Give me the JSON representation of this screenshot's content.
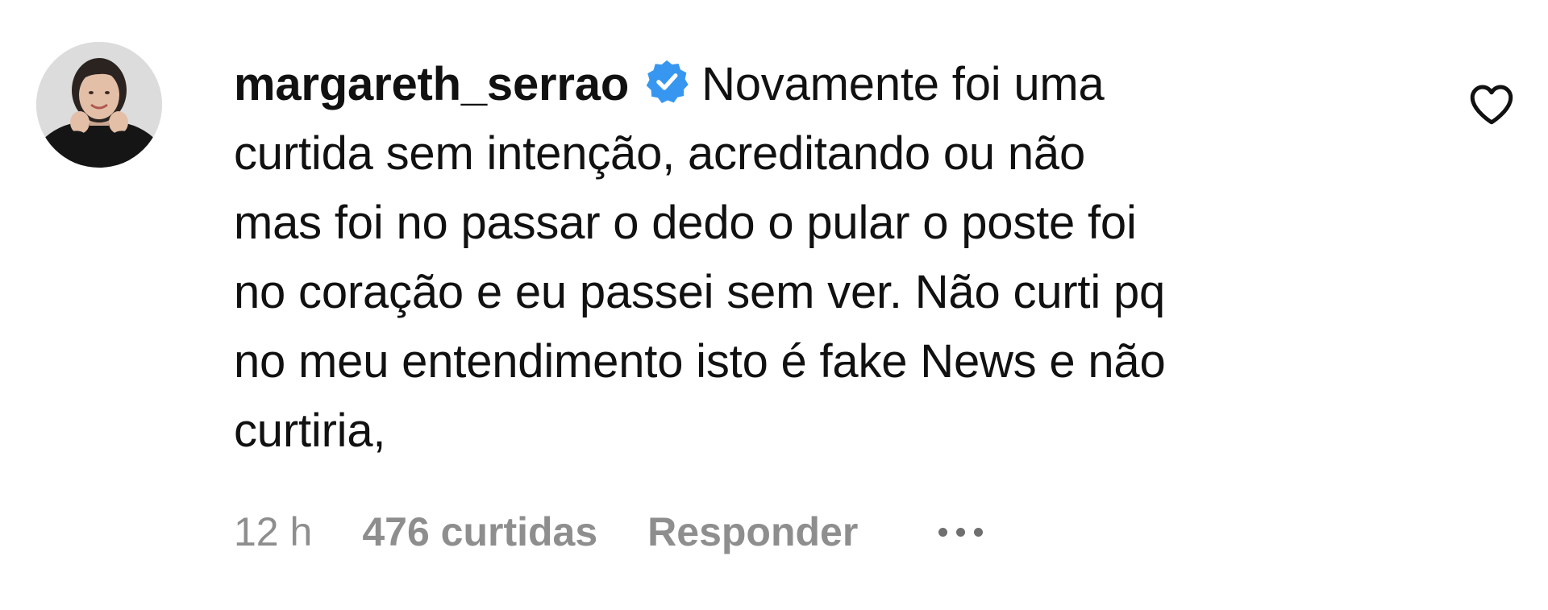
{
  "comment": {
    "username": "margareth_serrao",
    "verified": true,
    "text_lines": [
      "Novamente foi uma",
      "curtida sem intenção, acreditando ou não",
      "mas foi no passar o dedo o pular o poste foi",
      "no coração e eu passei sem ver. Não curti pq",
      "no meu entendimento isto é fake News e não",
      "curtiria,"
    ],
    "time": "12 h",
    "likes_label": "476 curtidas",
    "reply_label": "Responder"
  },
  "icons": {
    "verified": "verified-badge-icon",
    "like": "heart-icon",
    "more": "more-options-icon"
  },
  "colors": {
    "text": "#111111",
    "meta": "#8e8e8e",
    "verified_blue": "#3797f0"
  }
}
